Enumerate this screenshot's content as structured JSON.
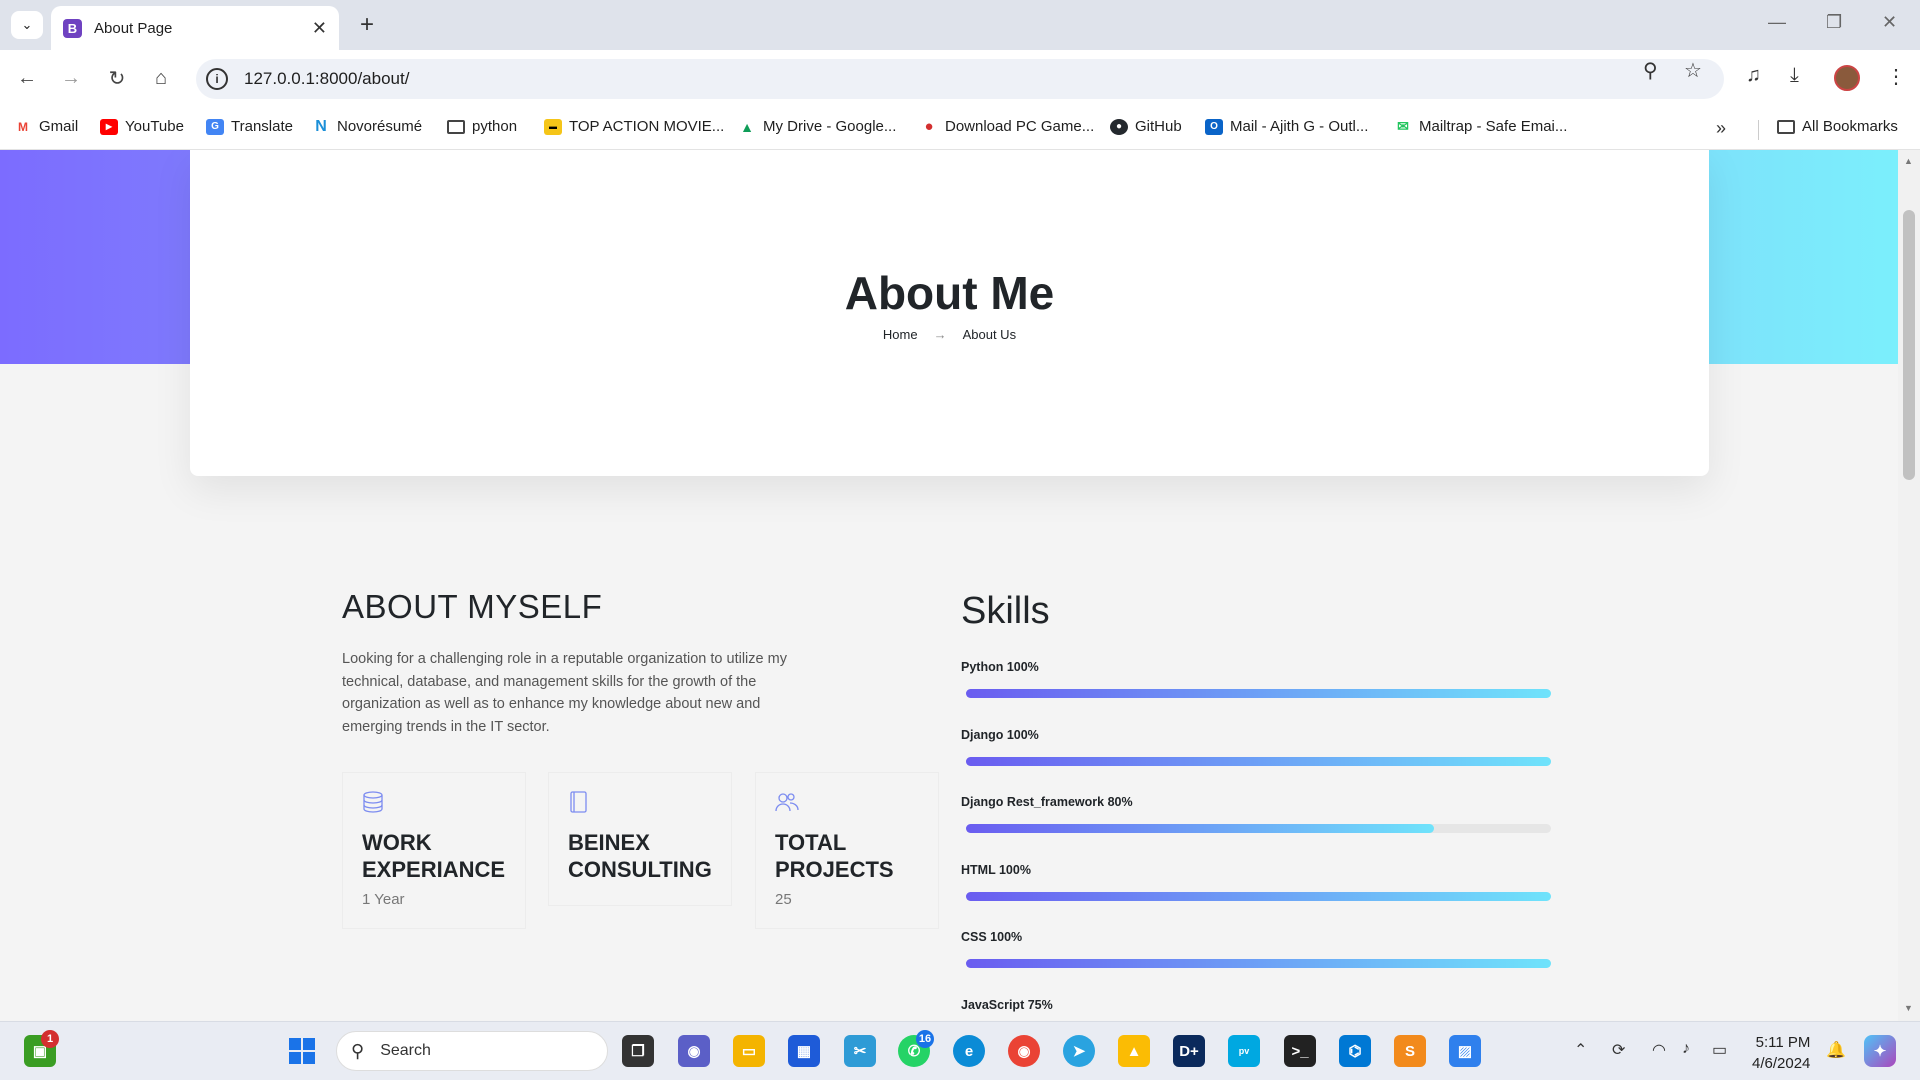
{
  "browser": {
    "tab_title": "About Page",
    "tab_favicon": "B",
    "url": "127.0.0.1:8000/about/"
  },
  "bookmarks": [
    {
      "label": "Gmail",
      "icon": "gmail-icon",
      "color": "#ea4335"
    },
    {
      "label": "YouTube",
      "icon": "youtube-icon",
      "color": "#ff0000"
    },
    {
      "label": "Translate",
      "icon": "translate-icon",
      "color": "#4285f4"
    },
    {
      "label": "Novorésumé",
      "icon": "novoresume-icon",
      "color": "#1b8fd8"
    },
    {
      "label": "python",
      "icon": "folder-icon",
      "color": "#444444"
    },
    {
      "label": "TOP ACTION MOVIE...",
      "icon": "imdb-icon",
      "color": "#f5c518"
    },
    {
      "label": "My Drive - Google...",
      "icon": "drive-icon",
      "color": "#0f9d58"
    },
    {
      "label": "Download PC Game...",
      "icon": "game-icon",
      "color": "#d32f2f"
    },
    {
      "label": "GitHub",
      "icon": "github-icon",
      "color": "#24292e"
    },
    {
      "label": "Mail - Ajith G - Outl...",
      "icon": "outlook-icon",
      "color": "#0a64c8"
    },
    {
      "label": "Mailtrap - Safe Emai...",
      "icon": "mailtrap-icon",
      "color": "#22c55e"
    }
  ],
  "all_bookmarks": "All Bookmarks",
  "hero": {
    "title": "About Me",
    "breadcrumb_home": "Home",
    "breadcrumb_arrow": "→",
    "breadcrumb_current": "About Us"
  },
  "about": {
    "heading": "ABOUT MYSELF",
    "text": "Looking for a challenging role in a reputable organization to utilize my technical, database, and management skills for the growth of the organization as well as to enhance my knowledge about new and emerging trends in the IT sector.",
    "cards": [
      {
        "icon": "database-icon",
        "title": "WORK EXPERIANCE",
        "value": "1 Year"
      },
      {
        "icon": "book-icon",
        "title": "BEINEX CONSULTING",
        "value": ""
      },
      {
        "icon": "users-icon",
        "title": "TOTAL PROJECTS",
        "value": "25"
      }
    ]
  },
  "skills": {
    "heading": "Skills",
    "items": [
      {
        "label": "Python 100%",
        "percent": 100
      },
      {
        "label": "Django 100%",
        "percent": 100
      },
      {
        "label": "Django Rest_framework 80%",
        "percent": 80
      },
      {
        "label": "HTML 100%",
        "percent": 100
      },
      {
        "label": "CSS 100%",
        "percent": 100
      },
      {
        "label": "JavaScript 75%",
        "percent": 75
      }
    ]
  },
  "taskbar": {
    "search_placeholder": "Search",
    "time": "5:11 PM",
    "date": "4/6/2024",
    "store_badge": "1",
    "whatsapp_badge": "16"
  },
  "colors": {
    "gradient_start": "#7c6cff",
    "gradient_end": "#7beffc",
    "text_dark": "#212529"
  }
}
